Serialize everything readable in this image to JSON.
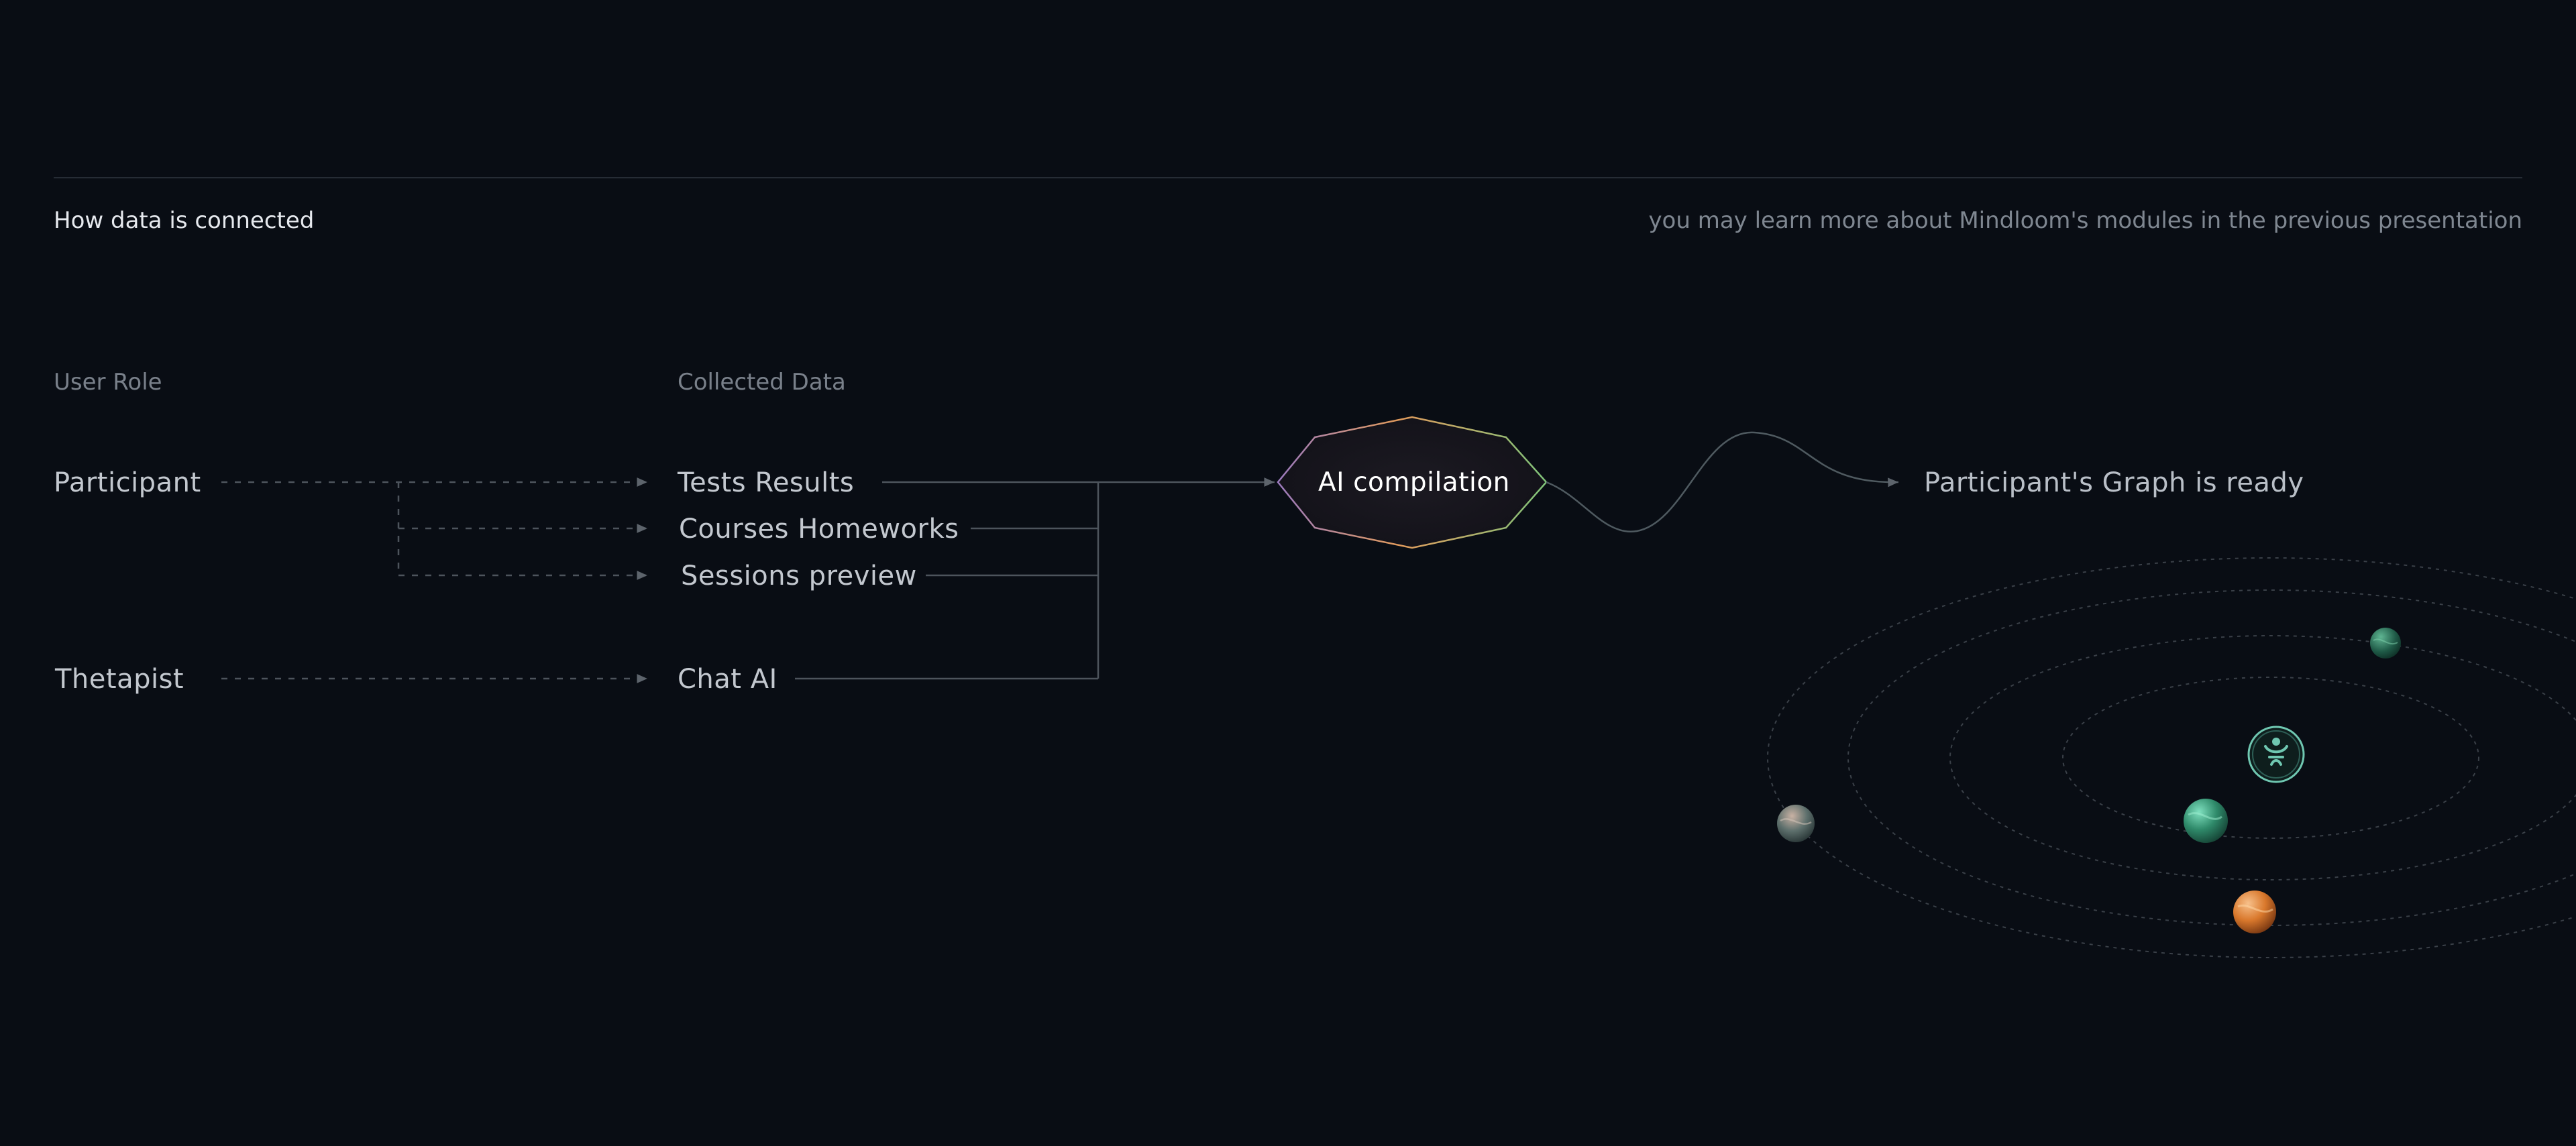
{
  "header": {
    "title": "How data is connected",
    "note": "you may learn more about Mindloom's modules in the previous presentation"
  },
  "columns": {
    "user_role": "User Role",
    "collected_data": "Collected Data"
  },
  "roles": {
    "participant": "Participant",
    "therapist": "Thetapist"
  },
  "data_items": {
    "tests": "Tests Results",
    "courses": "Courses Homeworks",
    "sessions": "Sessions preview",
    "chat": "Chat AI"
  },
  "core": {
    "label": "AI compilation"
  },
  "result": {
    "label": "Participant's Graph is ready"
  },
  "orbit": {
    "center_icon": "mindloom-logo-icon",
    "planets": [
      "teal-planet-icon",
      "green-planet-icon",
      "orange-planet-icon",
      "gray-planet-icon"
    ]
  },
  "colors": {
    "background": "#090d14",
    "line": "#4a5058",
    "accent": "#6fc7b1",
    "orange": "#e68a3c"
  }
}
